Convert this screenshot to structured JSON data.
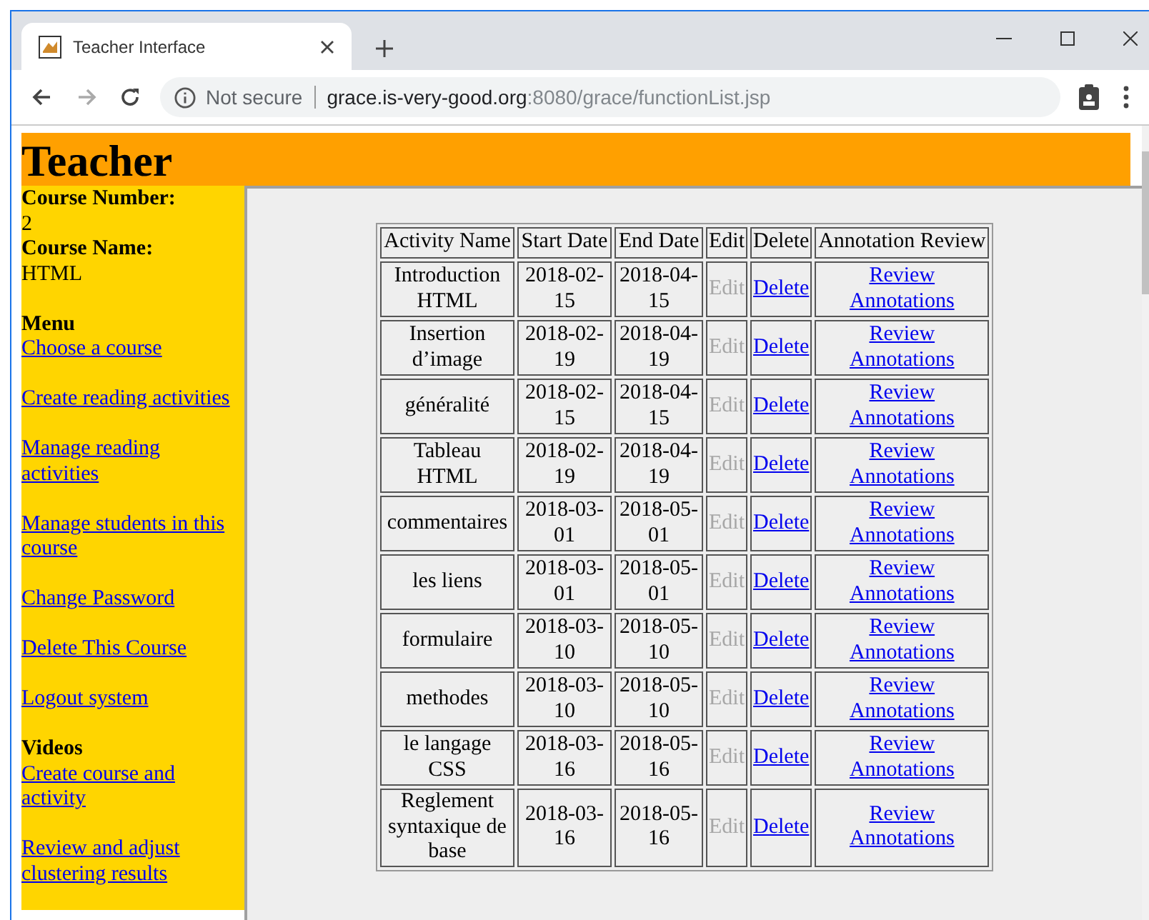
{
  "browser": {
    "tab_title": "Teacher Interface",
    "security": "Not secure",
    "host": "grace.is-very-good.org",
    "path": ":8080/grace/functionList.jsp"
  },
  "header": {
    "title": "Teacher"
  },
  "sidebar": {
    "fields": [
      {
        "label": "Course Number:",
        "value": "2"
      },
      {
        "label": "Course Name:",
        "value": "HTML"
      }
    ],
    "sections": [
      {
        "heading": "Menu",
        "links": [
          "Choose a course",
          "Create reading activities",
          "Manage reading activities",
          "Manage students in this course",
          "Change Password",
          "Delete This Course",
          "Logout system"
        ]
      },
      {
        "heading": "Videos",
        "links": [
          "Create course and activity",
          "Review and adjust clustering results"
        ]
      }
    ]
  },
  "table": {
    "columns": [
      "Activity Name",
      "Start Date",
      "End Date",
      "Edit",
      "Delete",
      "Annotation Review"
    ],
    "rows": [
      {
        "activity_name": "Introduction HTML",
        "start_date": "2018-02-15",
        "end_date": "2018-04-15",
        "edit": {
          "label": "Edit",
          "disabled": true
        },
        "delete": "Delete",
        "review": "Review Annotations"
      },
      {
        "activity_name": "Insertion d’image",
        "start_date": "2018-02-19",
        "end_date": "2018-04-19",
        "edit": {
          "label": "Edit",
          "disabled": true
        },
        "delete": "Delete",
        "review": "Review Annotations"
      },
      {
        "activity_name": "généralité",
        "start_date": "2018-02-15",
        "end_date": "2018-04-15",
        "edit": {
          "label": "Edit",
          "disabled": true
        },
        "delete": "Delete",
        "review": "Review Annotations"
      },
      {
        "activity_name": "Tableau HTML",
        "start_date": "2018-02-19",
        "end_date": "2018-04-19",
        "edit": {
          "label": "Edit",
          "disabled": true
        },
        "delete": "Delete",
        "review": "Review Annotations"
      },
      {
        "activity_name": "commentaires",
        "start_date": "2018-03-01",
        "end_date": "2018-05-01",
        "edit": {
          "label": "Edit",
          "disabled": true
        },
        "delete": "Delete",
        "review": "Review Annotations"
      },
      {
        "activity_name": "les liens",
        "start_date": "2018-03-01",
        "end_date": "2018-05-01",
        "edit": {
          "label": "Edit",
          "disabled": true
        },
        "delete": "Delete",
        "review": "Review Annotations"
      },
      {
        "activity_name": "formulaire",
        "start_date": "2018-03-10",
        "end_date": "2018-05-10",
        "edit": {
          "label": "Edit",
          "disabled": true
        },
        "delete": "Delete",
        "review": "Review Annotations"
      },
      {
        "activity_name": "methodes",
        "start_date": "2018-03-10",
        "end_date": "2018-05-10",
        "edit": {
          "label": "Edit",
          "disabled": true
        },
        "delete": "Delete",
        "review": "Review Annotations"
      },
      {
        "activity_name": "le langage CSS",
        "start_date": "2018-03-16",
        "end_date": "2018-05-16",
        "edit": {
          "label": "Edit",
          "disabled": true
        },
        "delete": "Delete",
        "review": "Review Annotations"
      },
      {
        "activity_name": "Reglement syntaxique de base",
        "start_date": "2018-03-16",
        "end_date": "2018-05-16",
        "edit": {
          "label": "Edit",
          "disabled": true
        },
        "delete": "Delete",
        "review": "Review Annotations"
      }
    ]
  }
}
